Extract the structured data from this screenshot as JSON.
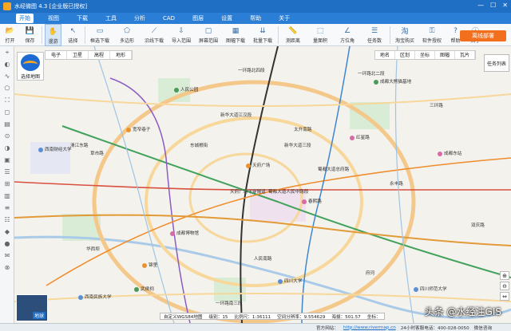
{
  "app": {
    "title": "水经微图 4.3 [企业版已授权]",
    "close_glyph": "✕",
    "min_glyph": "—",
    "max_glyph": "☐"
  },
  "menu": [
    "开始",
    "视图",
    "下载",
    "工具",
    "分析",
    "CAD",
    "图层",
    "设置",
    "帮助",
    "关于"
  ],
  "toolbar": [
    {
      "label": "打开",
      "icon": "folder-icon",
      "glyph": "📂"
    },
    {
      "label": "保存",
      "icon": "save-icon",
      "glyph": "💾"
    },
    {
      "label": "漫游",
      "icon": "hand-icon",
      "glyph": "✋",
      "selected": true
    },
    {
      "label": "选择",
      "icon": "select-icon",
      "glyph": "↖"
    },
    {
      "label": "框选下载",
      "icon": "rect-select-icon",
      "glyph": "▭"
    },
    {
      "label": "多边形",
      "icon": "polygon-icon",
      "glyph": "⬠"
    },
    {
      "label": "沿线下载",
      "icon": "line-download-icon",
      "glyph": "⟋"
    },
    {
      "label": "导入范围",
      "icon": "import-range-icon",
      "glyph": "⇩"
    },
    {
      "label": "屏幕范围",
      "icon": "screen-range-icon",
      "glyph": "▢"
    },
    {
      "label": "图幅下载",
      "icon": "sheet-download-icon",
      "glyph": "▦"
    },
    {
      "label": "批量下载",
      "icon": "batch-download-icon",
      "glyph": "⇊"
    },
    {
      "label": "测距离",
      "icon": "measure-distance-icon",
      "glyph": "📏"
    },
    {
      "label": "量面积",
      "icon": "measure-area-icon",
      "glyph": "⬚"
    },
    {
      "label": "方位角",
      "icon": "bearing-icon",
      "glyph": "∠"
    },
    {
      "label": "任务数",
      "icon": "task-icon",
      "glyph": "☰"
    },
    {
      "label": "淘宝购买",
      "icon": "taobao-icon",
      "glyph": "淘"
    },
    {
      "label": "软件授权",
      "icon": "license-icon",
      "glyph": "⚿"
    },
    {
      "label": "帮助",
      "icon": "help-icon",
      "glyph": "?"
    },
    {
      "label": "关于",
      "icon": "about-icon",
      "glyph": "ⓘ"
    }
  ],
  "enterprise_button": "离线部署",
  "left_tools": [
    "⌖",
    "◐",
    "∿",
    "⬠",
    "⛶",
    "◻",
    "▤",
    "⊙",
    "◑",
    "▣",
    "☰",
    "⊞",
    "▥",
    "≡",
    "☷",
    "◆",
    "●",
    "✉",
    "⊗"
  ],
  "map_type_tabs": [
    "电子",
    "卫星",
    "高程",
    "地形"
  ],
  "map_right_tabs": [
    "地名",
    "区划",
    "坐标",
    "图幅",
    "瓦片"
  ],
  "task_list": "任务列表",
  "select_map": "选择地图",
  "globe_label": "地球",
  "zoom_controls": [
    "⊕",
    "⊖",
    "⇔"
  ],
  "coord_bar": {
    "projection": "自定义WGS84地图",
    "level_label": "级别：",
    "level": "15",
    "scale_label": "比例尺：",
    "scale": "1:36111",
    "resolution_label": "空间分辨率：",
    "resolution": "9.554629",
    "height_label": "海拔：",
    "height": "501.57",
    "angle_label": "坐标："
  },
  "status": {
    "website_label": "官方网站：",
    "website": "http://www.rivermap.cn",
    "hotline": "24小时客服电话：400-028-0050",
    "wechat": "微信咨询"
  },
  "watermark": "头条 @水经注GIS",
  "map_labels": [
    {
      "t": "一环路北四段"
    },
    {
      "t": "一环路北二段"
    },
    {
      "t": "新华大道江汉段"
    },
    {
      "t": "蜀都大道人民中路段"
    },
    {
      "t": "天府广场下穿隧道"
    },
    {
      "t": "新华大道三段"
    },
    {
      "t": "蜀都大道总府路"
    },
    {
      "t": "永丰路"
    },
    {
      "t": "草市路"
    },
    {
      "t": "清江东路"
    },
    {
      "t": "人民南路"
    },
    {
      "t": "一环路南三段"
    },
    {
      "t": "双庆路"
    },
    {
      "t": "华西坝"
    },
    {
      "t": "府河"
    },
    {
      "t": "三环路"
    },
    {
      "t": "东城根街"
    },
    {
      "t": "太升南路"
    }
  ],
  "pois": [
    {
      "t": "天府广场",
      "c": "o"
    },
    {
      "t": "四川大学",
      "c": "b"
    },
    {
      "t": "人民公园",
      "c": "g"
    },
    {
      "t": "成都博物馆",
      "c": "p"
    },
    {
      "t": "西南财经大学",
      "c": "b"
    },
    {
      "t": "成都东站",
      "c": "p"
    },
    {
      "t": "红星路",
      "c": "p"
    },
    {
      "t": "武侯祠",
      "c": "g"
    },
    {
      "t": "宽窄巷子",
      "c": "o"
    },
    {
      "t": "春熙路",
      "c": "p"
    },
    {
      "t": "锦里",
      "c": "o"
    },
    {
      "t": "西南民族大学",
      "c": "b"
    },
    {
      "t": "四川师范大学",
      "c": "b"
    },
    {
      "t": "成都大熊猫基地",
      "c": "g"
    }
  ]
}
